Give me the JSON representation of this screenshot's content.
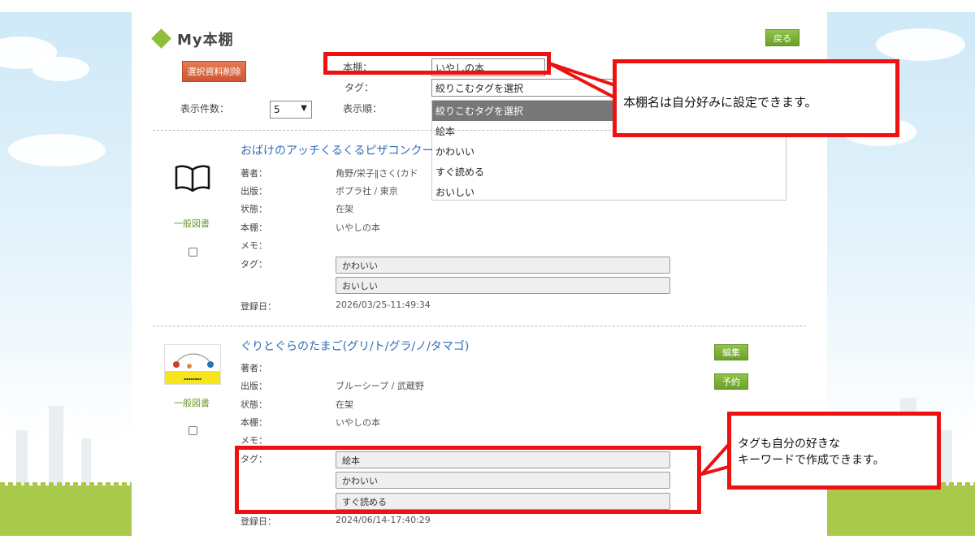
{
  "page": {
    "title": "My本棚",
    "back_button": "戻る",
    "delete_selected_button": "選択資料削除",
    "display_count_label": "表示件数：",
    "display_count_value": "5",
    "bookshelf_label": "本棚：",
    "bookshelf_value": "いやしの本",
    "tag_label": "タグ：",
    "tag_select_value": "絞りこむタグを選択",
    "sort_label": "表示順：",
    "tag_options": [
      "絞りこむタグを選択",
      "絵本",
      "かわいい",
      "すぐ読める",
      "おいしい"
    ]
  },
  "books": [
    {
      "title": "おばけのアッチくるくるピザコンクー",
      "category": "一般図書",
      "author_label": "著者：",
      "author_value": "角野/栄子‖さく(カド",
      "publisher_label": "出版：",
      "publisher_value": "ポプラ社 / 東京",
      "status_label": "状態：",
      "status_value": "在架",
      "shelf_label": "本棚：",
      "shelf_value": "いやしの本",
      "memo_label": "メモ：",
      "tag_label": "タグ：",
      "tags": [
        "かわいい",
        "おいしい"
      ],
      "registered_label": "登録日：",
      "registered_value": "2026/03/25-11:49:34"
    },
    {
      "title": "ぐりとぐらのたまご(グリ/ト/グラ/ノ/タマゴ)",
      "category": "一般図書",
      "edit_button": "編集",
      "reserve_button": "予約",
      "author_label": "著者：",
      "publisher_label": "出版：",
      "publisher_value": "ブルーシープ / 武蔵野",
      "status_label": "状態：",
      "status_value": "在架",
      "shelf_label": "本棚：",
      "shelf_value": "いやしの本",
      "memo_label": "メモ：",
      "tag_label": "タグ：",
      "tags": [
        "絵本",
        "かわいい",
        "すぐ読める"
      ],
      "registered_label": "登録日：",
      "registered_value": "2024/06/14-17:40:29"
    }
  ],
  "callouts": {
    "shelf_name": "本棚名は自分好みに設定できます。",
    "tags_line1": "タグも自分の好きな",
    "tags_line2": "キーワードで作成できます。"
  },
  "colors": {
    "accent_green": "#7cb342",
    "delete_red": "#d9623a",
    "highlight_red": "#ee1111",
    "link_blue": "#2f6db5"
  }
}
